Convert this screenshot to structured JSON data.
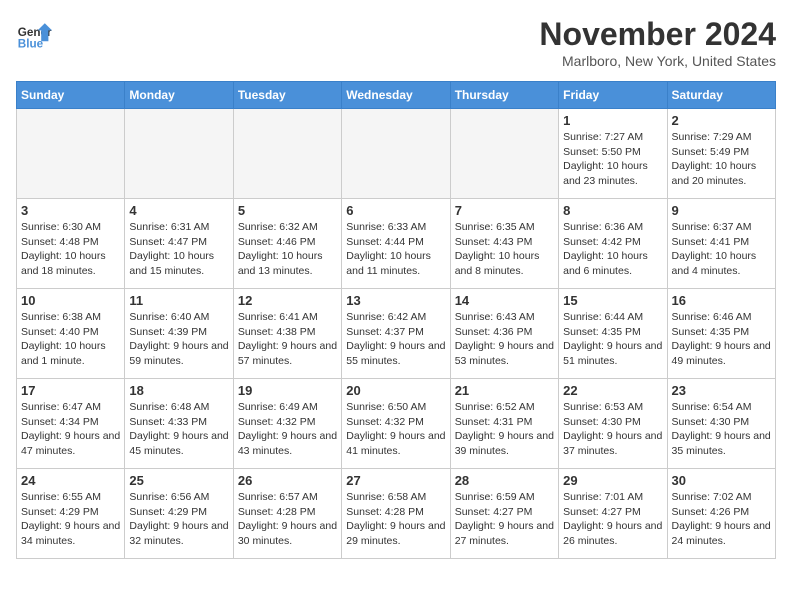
{
  "logo": {
    "line1": "General",
    "line2": "Blue"
  },
  "title": "November 2024",
  "location": "Marlboro, New York, United States",
  "weekdays": [
    "Sunday",
    "Monday",
    "Tuesday",
    "Wednesday",
    "Thursday",
    "Friday",
    "Saturday"
  ],
  "weeks": [
    [
      {
        "day": "",
        "info": ""
      },
      {
        "day": "",
        "info": ""
      },
      {
        "day": "",
        "info": ""
      },
      {
        "day": "",
        "info": ""
      },
      {
        "day": "",
        "info": ""
      },
      {
        "day": "1",
        "info": "Sunrise: 7:27 AM\nSunset: 5:50 PM\nDaylight: 10 hours and 23 minutes."
      },
      {
        "day": "2",
        "info": "Sunrise: 7:29 AM\nSunset: 5:49 PM\nDaylight: 10 hours and 20 minutes."
      }
    ],
    [
      {
        "day": "3",
        "info": "Sunrise: 6:30 AM\nSunset: 4:48 PM\nDaylight: 10 hours and 18 minutes."
      },
      {
        "day": "4",
        "info": "Sunrise: 6:31 AM\nSunset: 4:47 PM\nDaylight: 10 hours and 15 minutes."
      },
      {
        "day": "5",
        "info": "Sunrise: 6:32 AM\nSunset: 4:46 PM\nDaylight: 10 hours and 13 minutes."
      },
      {
        "day": "6",
        "info": "Sunrise: 6:33 AM\nSunset: 4:44 PM\nDaylight: 10 hours and 11 minutes."
      },
      {
        "day": "7",
        "info": "Sunrise: 6:35 AM\nSunset: 4:43 PM\nDaylight: 10 hours and 8 minutes."
      },
      {
        "day": "8",
        "info": "Sunrise: 6:36 AM\nSunset: 4:42 PM\nDaylight: 10 hours and 6 minutes."
      },
      {
        "day": "9",
        "info": "Sunrise: 6:37 AM\nSunset: 4:41 PM\nDaylight: 10 hours and 4 minutes."
      }
    ],
    [
      {
        "day": "10",
        "info": "Sunrise: 6:38 AM\nSunset: 4:40 PM\nDaylight: 10 hours and 1 minute."
      },
      {
        "day": "11",
        "info": "Sunrise: 6:40 AM\nSunset: 4:39 PM\nDaylight: 9 hours and 59 minutes."
      },
      {
        "day": "12",
        "info": "Sunrise: 6:41 AM\nSunset: 4:38 PM\nDaylight: 9 hours and 57 minutes."
      },
      {
        "day": "13",
        "info": "Sunrise: 6:42 AM\nSunset: 4:37 PM\nDaylight: 9 hours and 55 minutes."
      },
      {
        "day": "14",
        "info": "Sunrise: 6:43 AM\nSunset: 4:36 PM\nDaylight: 9 hours and 53 minutes."
      },
      {
        "day": "15",
        "info": "Sunrise: 6:44 AM\nSunset: 4:35 PM\nDaylight: 9 hours and 51 minutes."
      },
      {
        "day": "16",
        "info": "Sunrise: 6:46 AM\nSunset: 4:35 PM\nDaylight: 9 hours and 49 minutes."
      }
    ],
    [
      {
        "day": "17",
        "info": "Sunrise: 6:47 AM\nSunset: 4:34 PM\nDaylight: 9 hours and 47 minutes."
      },
      {
        "day": "18",
        "info": "Sunrise: 6:48 AM\nSunset: 4:33 PM\nDaylight: 9 hours and 45 minutes."
      },
      {
        "day": "19",
        "info": "Sunrise: 6:49 AM\nSunset: 4:32 PM\nDaylight: 9 hours and 43 minutes."
      },
      {
        "day": "20",
        "info": "Sunrise: 6:50 AM\nSunset: 4:32 PM\nDaylight: 9 hours and 41 minutes."
      },
      {
        "day": "21",
        "info": "Sunrise: 6:52 AM\nSunset: 4:31 PM\nDaylight: 9 hours and 39 minutes."
      },
      {
        "day": "22",
        "info": "Sunrise: 6:53 AM\nSunset: 4:30 PM\nDaylight: 9 hours and 37 minutes."
      },
      {
        "day": "23",
        "info": "Sunrise: 6:54 AM\nSunset: 4:30 PM\nDaylight: 9 hours and 35 minutes."
      }
    ],
    [
      {
        "day": "24",
        "info": "Sunrise: 6:55 AM\nSunset: 4:29 PM\nDaylight: 9 hours and 34 minutes."
      },
      {
        "day": "25",
        "info": "Sunrise: 6:56 AM\nSunset: 4:29 PM\nDaylight: 9 hours and 32 minutes."
      },
      {
        "day": "26",
        "info": "Sunrise: 6:57 AM\nSunset: 4:28 PM\nDaylight: 9 hours and 30 minutes."
      },
      {
        "day": "27",
        "info": "Sunrise: 6:58 AM\nSunset: 4:28 PM\nDaylight: 9 hours and 29 minutes."
      },
      {
        "day": "28",
        "info": "Sunrise: 6:59 AM\nSunset: 4:27 PM\nDaylight: 9 hours and 27 minutes."
      },
      {
        "day": "29",
        "info": "Sunrise: 7:01 AM\nSunset: 4:27 PM\nDaylight: 9 hours and 26 minutes."
      },
      {
        "day": "30",
        "info": "Sunrise: 7:02 AM\nSunset: 4:26 PM\nDaylight: 9 hours and 24 minutes."
      }
    ]
  ]
}
